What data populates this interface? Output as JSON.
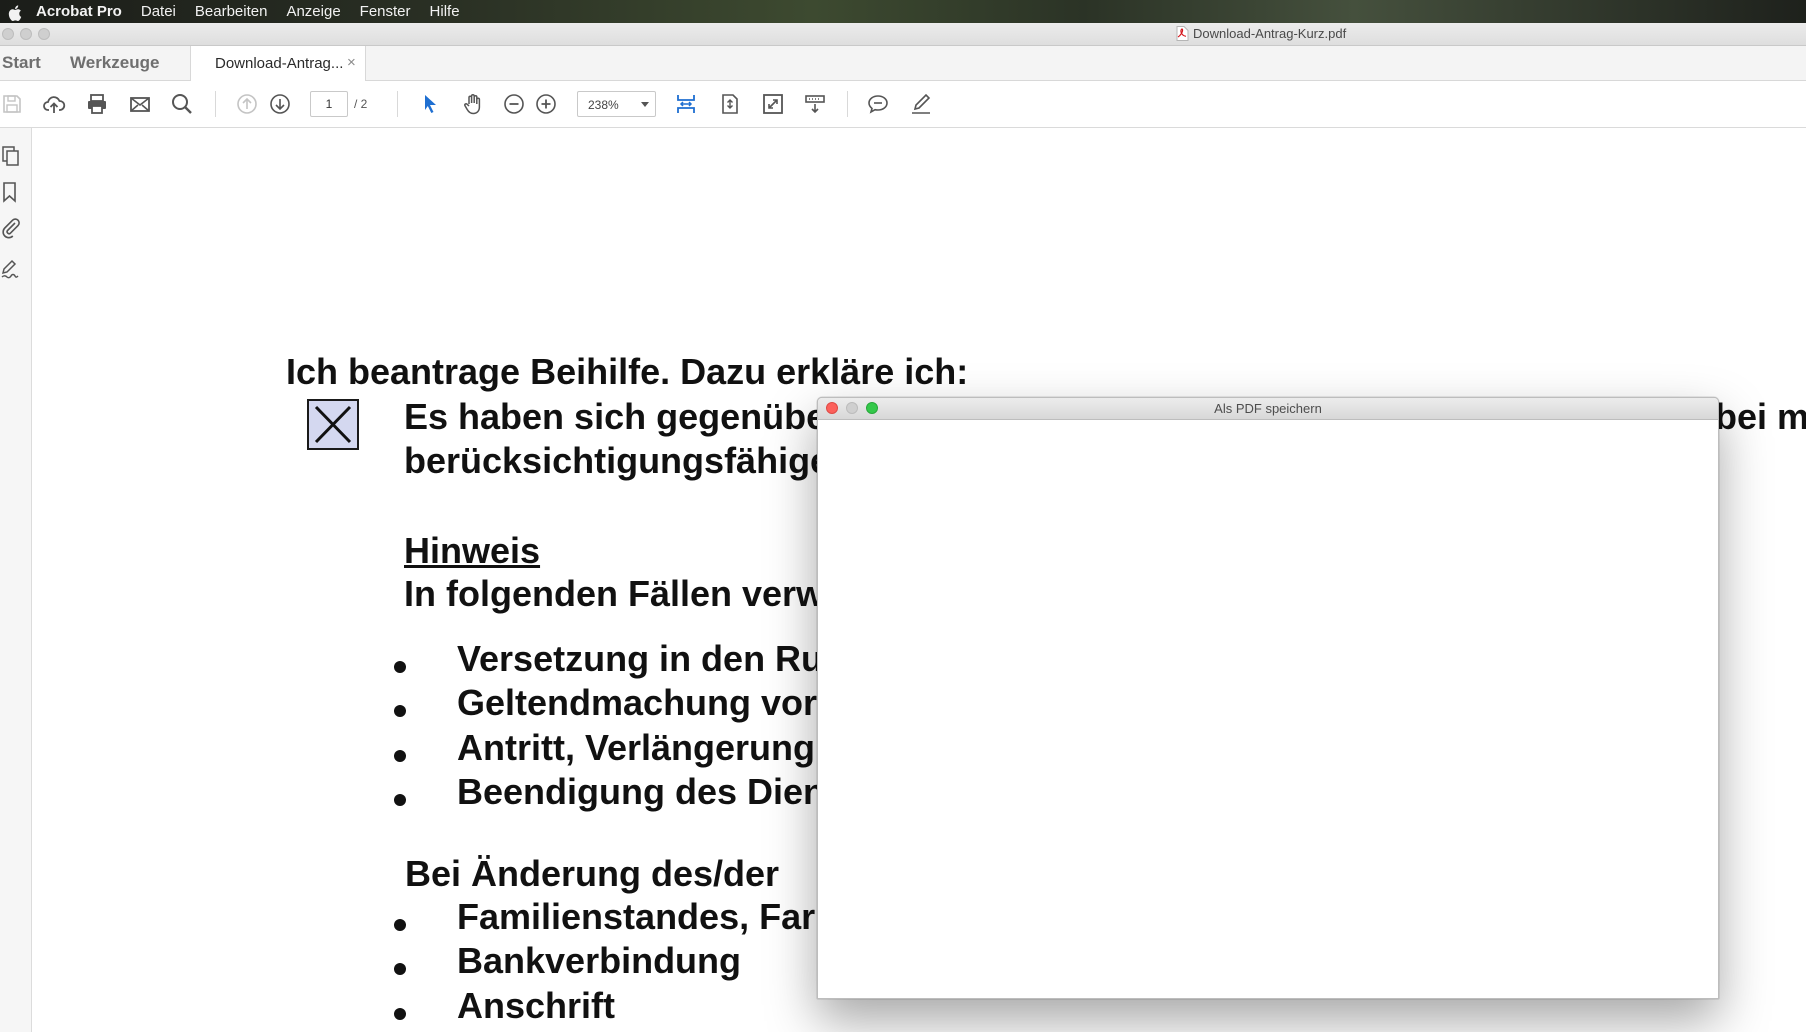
{
  "menubar": {
    "items": [
      "Acrobat Pro",
      "Datei",
      "Bearbeiten",
      "Anzeige",
      "Fenster",
      "Hilfe"
    ]
  },
  "window": {
    "title": "Download-Antrag-Kurz.pdf"
  },
  "tabs": {
    "start": "Start",
    "tools": "Werkzeuge",
    "document": "Download-Antrag...",
    "close": "×"
  },
  "toolbar": {
    "icons": [
      "save-icon",
      "upload-cloud-icon",
      "print-icon",
      "mail-icon",
      "search-icon",
      "page-up-icon",
      "page-down-icon",
      "select-pointer-icon",
      "hand-tool-icon",
      "zoom-out-icon",
      "zoom-in-icon",
      "fit-width-icon",
      "fit-page-icon",
      "full-screen-icon",
      "scroll-mode-icon",
      "comment-icon",
      "sign-pen-icon"
    ],
    "page_current": "1",
    "page_total": "/ 2",
    "zoom": "238%"
  },
  "leftpane": {
    "icons": [
      "pages-icon",
      "bookmark-icon",
      "attachment-icon",
      "signature-icon"
    ]
  },
  "document": {
    "heading": "Ich beantrage Beihilfe. Dazu erkläre ich:",
    "checkbox_checked": true,
    "para_line1_left": "Es haben sich gegenübe",
    "para_line1_right": "bei mi",
    "para_line2": "berücksichtigungsfähige",
    "hinweis": "Hinweis",
    "hinweis_text": "In folgenden Fällen verw",
    "list1": [
      "Versetzung in den Ru",
      "Geltendmachung vor",
      "Antritt, Verlängerung",
      "Beendigung des Dien"
    ],
    "aenderung_heading": "Bei Änderung des/der",
    "list2": [
      "Familienstandes, Far",
      "Bankverbindung",
      "Anschrift"
    ]
  },
  "dialog": {
    "title": "Als PDF speichern"
  },
  "colors": {
    "dialog_close": "#fc605b",
    "dialog_maximize": "#34c84a",
    "checkbox_fill": "#d4d8f0",
    "selection_accent": "#1f6fd1"
  }
}
